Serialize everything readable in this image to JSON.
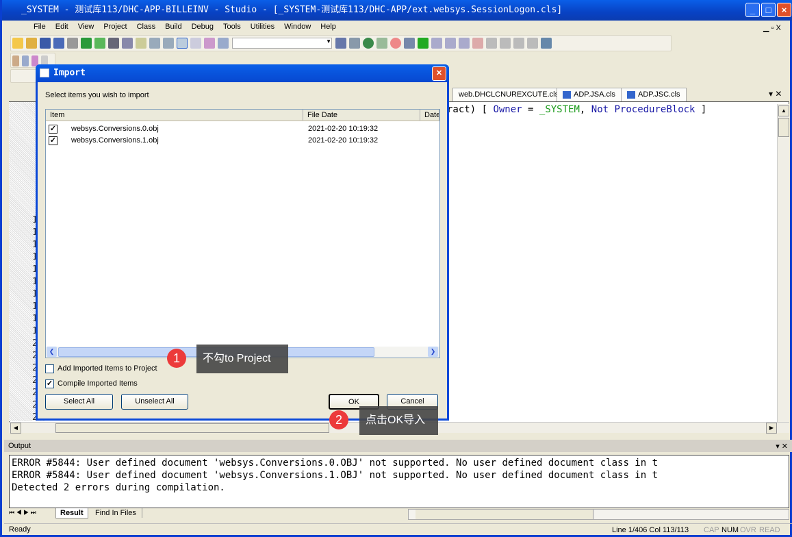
{
  "window": {
    "title": "_SYSTEM - 测试库113/DHC-APP-BILLEINV - Studio - [_SYSTEM-测试库113/DHC-APP/ext.websys.SessionLogon.cls]"
  },
  "menu": [
    "File",
    "Edit",
    "View",
    "Project",
    "Class",
    "Build",
    "Debug",
    "Tools",
    "Utilities",
    "Window",
    "Help"
  ],
  "editor": {
    "tabs": [
      "web.DHCLCNUREXCUTE.cls",
      "ADP.JSA.cls",
      "ADP.JSC.cls"
    ],
    "code_line": {
      "p1": "ract) [ ",
      "kw1": "Owner",
      "p2": " = ",
      "val": "_SYSTEM",
      "p3": ", ",
      "kw2": "Not ProcedureBlock",
      "p4": " ]"
    },
    "line_numbers": [
      "1",
      "1",
      "1",
      "1",
      "1",
      "1",
      "1",
      "1",
      "1",
      "1",
      "2",
      "2",
      "2",
      "2",
      "2",
      "2",
      "2"
    ]
  },
  "dialog": {
    "title": "Import",
    "instruction": "Select items you wish to import",
    "columns": [
      "Item",
      "File Date",
      "Date"
    ],
    "rows": [
      {
        "item": "websys.Conversions.0.obj",
        "date": "2021-02-20 10:19:32",
        "checked": true
      },
      {
        "item": "websys.Conversions.1.obj",
        "date": "2021-02-20 10:19:32",
        "checked": true
      }
    ],
    "add_to_project": {
      "label": "Add Imported Items to Project",
      "checked": false
    },
    "compile": {
      "label": "Compile Imported Items",
      "checked": true
    },
    "select_all": "Select All",
    "unselect_all": "Unselect All",
    "ok": "OK",
    "cancel": "Cancel"
  },
  "annotations": [
    {
      "number": "1",
      "text": "不勾to Project"
    },
    {
      "number": "2",
      "text": "点击OK导入"
    }
  ],
  "output": {
    "title": "Output",
    "lines": [
      "ERROR #5844: User defined document 'websys.Conversions.0.OBJ' not supported. No user defined document class in t",
      "ERROR #5844: User defined document 'websys.Conversions.1.OBJ' not supported. No user defined document class in t",
      "Detected 2 errors during compilation."
    ],
    "tabs": [
      "Result",
      "Find In Files"
    ]
  },
  "status": {
    "text": "Ready",
    "position": "Line 1/406 Col 113/113",
    "indicators": [
      "CAP",
      "NUM",
      "OVR",
      "READ"
    ]
  }
}
